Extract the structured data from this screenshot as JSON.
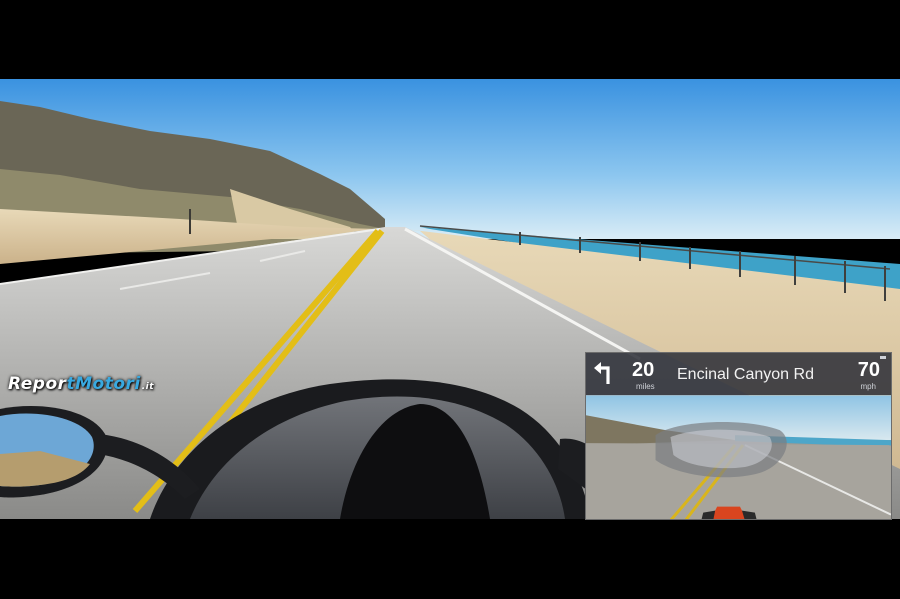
{
  "watermark": {
    "part1": "Repor",
    "part2": "tMotori",
    "tld": ".it"
  },
  "hud": {
    "turn_icon": "turn-left-arrow-icon",
    "distance_value": "20",
    "distance_unit": "miles",
    "street_name": "Encinal Canyon Rd",
    "speed_value": "70",
    "speed_unit": "mph"
  },
  "colors": {
    "road_line_yellow": "#e8c31a",
    "sky": "#4aa3e8",
    "ocean": "#3a9fc4",
    "hud_bar": "#30323a"
  }
}
